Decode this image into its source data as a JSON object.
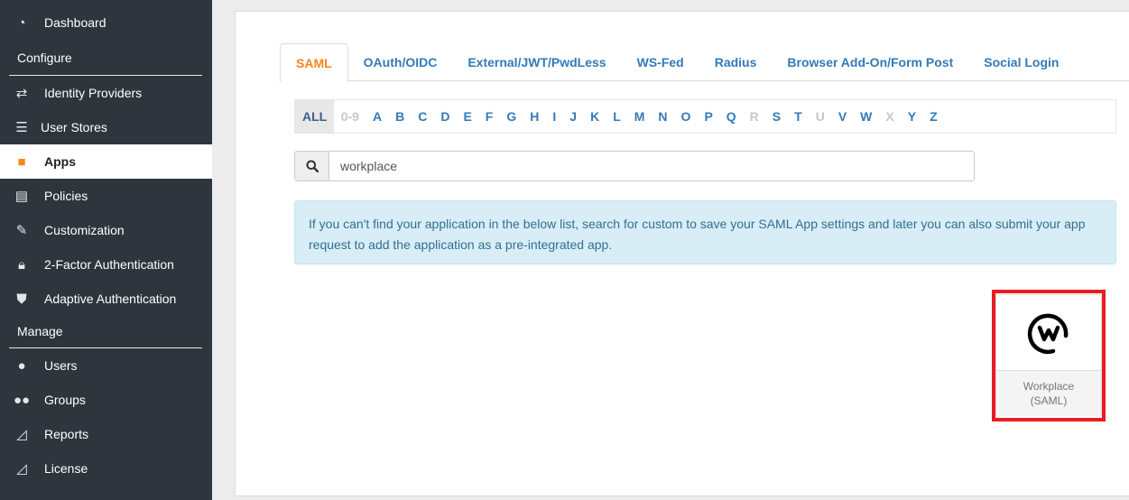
{
  "sidebar": {
    "items": [
      {
        "label": "Dashboard",
        "icon": "dashboard-icon"
      },
      {
        "label": "Identity Providers",
        "icon": "exchange-icon"
      },
      {
        "label": "User Stores",
        "icon": "database-icon"
      },
      {
        "label": "Apps",
        "icon": "cube-icon",
        "active": true
      },
      {
        "label": "Policies",
        "icon": "document-icon"
      },
      {
        "label": "Customization",
        "icon": "wrench-icon"
      },
      {
        "label": "2-Factor Authentication",
        "icon": "lock-icon"
      },
      {
        "label": "Adaptive Authentication",
        "icon": "shield-icon"
      },
      {
        "label": "Users",
        "icon": "user-icon"
      },
      {
        "label": "Groups",
        "icon": "users-icon"
      },
      {
        "label": "Reports",
        "icon": "area-chart-icon"
      },
      {
        "label": "License",
        "icon": "area-chart-icon"
      }
    ],
    "sections": {
      "configure": "Configure",
      "manage": "Manage"
    }
  },
  "tabs": [
    "SAML",
    "OAuth/OIDC",
    "External/JWT/PwdLess",
    "WS-Fed",
    "Radius",
    "Browser Add-On/Form Post",
    "Social Login"
  ],
  "active_tab": "SAML",
  "alphabet": [
    "ALL",
    "0-9",
    "A",
    "B",
    "C",
    "D",
    "E",
    "F",
    "G",
    "H",
    "I",
    "J",
    "K",
    "L",
    "M",
    "N",
    "O",
    "P",
    "Q",
    "R",
    "S",
    "T",
    "U",
    "V",
    "W",
    "X",
    "Y",
    "Z"
  ],
  "alphabet_disabled": [
    "0-9",
    "R",
    "U",
    "X"
  ],
  "search": {
    "value": "workplace"
  },
  "alert": "If you can't find your application in the below list, search for custom to save your SAML App settings and later you can also submit your app request to add the application as a pre-integrated app.",
  "app_card": {
    "name": "Workplace",
    "type": "(SAML)",
    "highlight_color": "#e81c24"
  },
  "colors": {
    "accent": "#f7861c",
    "link": "#337ab7",
    "sidebar_bg": "#2f353d"
  }
}
